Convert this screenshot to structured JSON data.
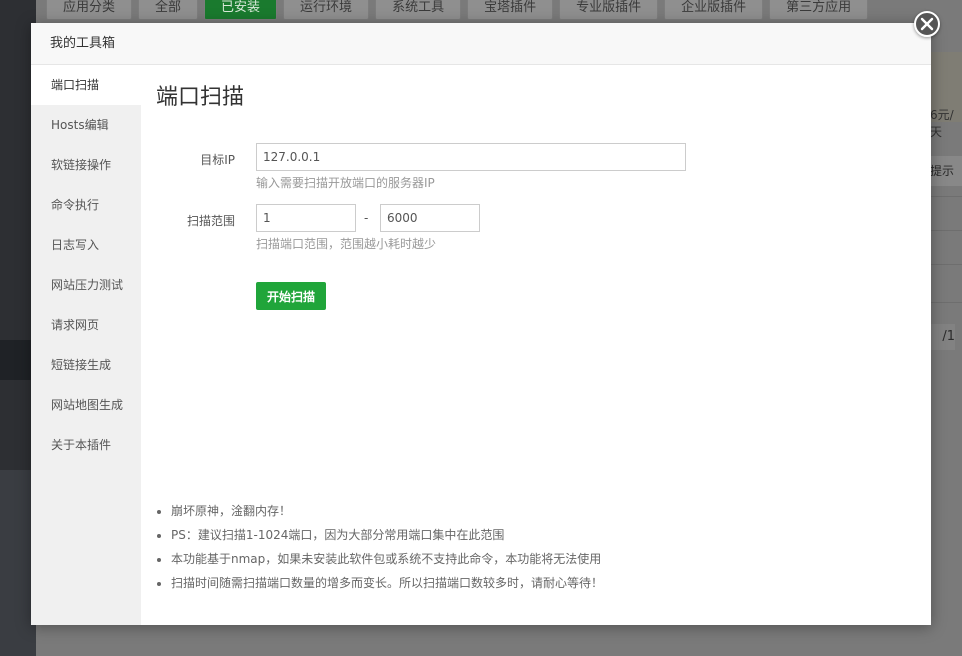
{
  "background": {
    "tabs": [
      "应用分类",
      "全部",
      "已安装",
      "运行环境",
      "系统工具",
      "宝塔插件",
      "专业版插件",
      "企业版插件",
      "第三方应用"
    ],
    "active_tab_index": 2,
    "price_fragment": "6元/天",
    "button_fragment": "提示",
    "pager_fragment": "/1"
  },
  "modal": {
    "title": "我的工具箱",
    "close_icon": "close-icon"
  },
  "sidebar": {
    "items": [
      {
        "label": "端口扫描",
        "active": true
      },
      {
        "label": "Hosts编辑",
        "active": false
      },
      {
        "label": "软链接操作",
        "active": false
      },
      {
        "label": "命令执行",
        "active": false
      },
      {
        "label": "日志写入",
        "active": false
      },
      {
        "label": "网站压力测试",
        "active": false
      },
      {
        "label": "请求网页",
        "active": false
      },
      {
        "label": "短链接生成",
        "active": false
      },
      {
        "label": "网站地图生成",
        "active": false
      },
      {
        "label": "关于本插件",
        "active": false
      }
    ]
  },
  "content": {
    "title": "端口扫描",
    "target_ip": {
      "label": "目标IP",
      "value": "127.0.0.1",
      "hint": "输入需要扫描开放端口的服务器IP"
    },
    "scan_range": {
      "label": "扫描范围",
      "start": "1",
      "separator": "-",
      "end": "6000",
      "hint": "扫描端口范围，范围越小耗时越少"
    },
    "start_button": "开始扫描",
    "tips": [
      "崩坏原神，淦翻内存！",
      "PS：建议扫描1-1024端口，因为大部分常用端口集中在此范围",
      "本功能基于nmap，如果未安装此软件包或系统不支持此命令，本功能将无法使用",
      "扫描时间随需扫描端口数量的增多而变长。所以扫描端口数较多时，请耐心等待！"
    ]
  },
  "colors": {
    "accent": "#20a53a",
    "overlay": "#7a7a7a"
  }
}
